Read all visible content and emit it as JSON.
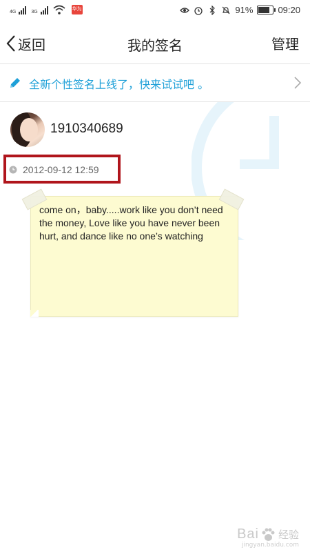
{
  "status_bar": {
    "net1": "4G",
    "net2": "3G",
    "app_badge": "华为",
    "battery": "91%",
    "battery_level": 0.91,
    "time": "09:20",
    "icons": [
      "eye-icon",
      "alarm-icon",
      "bluetooth-icon",
      "mute-icon",
      "battery-icon"
    ]
  },
  "navbar": {
    "back_label": "返回",
    "title": "我的签名",
    "manage_label": "管理"
  },
  "banner": {
    "text": "全新个性签名上线了，快来试试吧 。",
    "icon": "pencil-icon",
    "color": "#1ea0d8"
  },
  "profile": {
    "username": "1910340689"
  },
  "signature": {
    "date": "2012-09-12 12:59",
    "text": "come on，baby.....work like you don’t need the money, Love like you have never been hurt, and dance like no one’s watching"
  },
  "colors": {
    "accent": "#1ea0d8",
    "highlight_box": "#b0151c",
    "note_bg": "#fdfbd1"
  },
  "watermark": {
    "brand_left": "Bai",
    "brand_right": "经验",
    "url": "jingyan.baidu.com"
  }
}
